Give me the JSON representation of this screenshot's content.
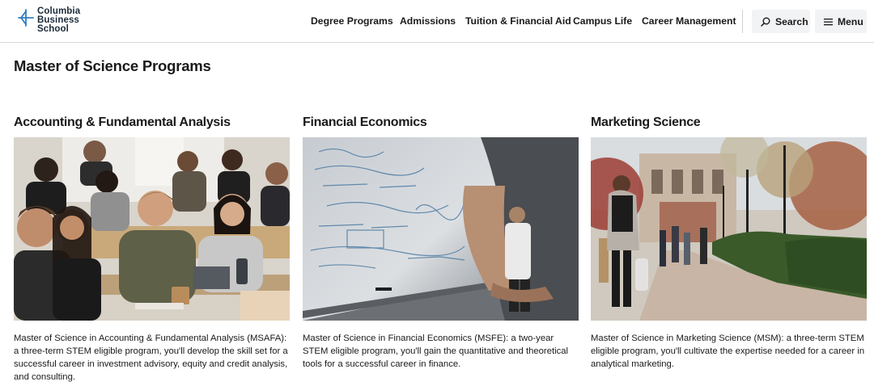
{
  "header": {
    "logo": {
      "line1": "Columbia",
      "line2": "Business",
      "line3": "School"
    },
    "nav": [
      {
        "label": "Degree Programs"
      },
      {
        "label": "Admissions"
      },
      {
        "label": "Tuition & Financial Aid"
      },
      {
        "label": "Campus Life"
      },
      {
        "label": "Career Management"
      }
    ],
    "search_label": "Search",
    "menu_label": "Menu"
  },
  "main": {
    "title": "Master of Science Programs",
    "cards": [
      {
        "title": "Accounting & Fundamental Analysis",
        "description": "Master of Science in Accounting & Fundamental Analysis (MSAFA): a three-term STEM eligible program, you'll develop the skill set for a successful career in investment advisory, equity and credit analysis, and consulting."
      },
      {
        "title": "Financial Economics",
        "description": "Master of Science in Financial Economics (MSFE): a two-year STEM eligible program, you'll gain the quantitative and theoretical tools for a successful career in finance."
      },
      {
        "title": "Marketing Science",
        "description": "Master of Science in Marketing Science (MSM): a three-term STEM eligible program, you'll cultivate the expertise needed for a career in analytical marketing."
      }
    ]
  },
  "colors": {
    "brand_navy": "#1b2a3a",
    "brand_blue": "#2d7dc3",
    "header_border": "#d9d9d9",
    "pill_bg": "#f2f3f5"
  }
}
